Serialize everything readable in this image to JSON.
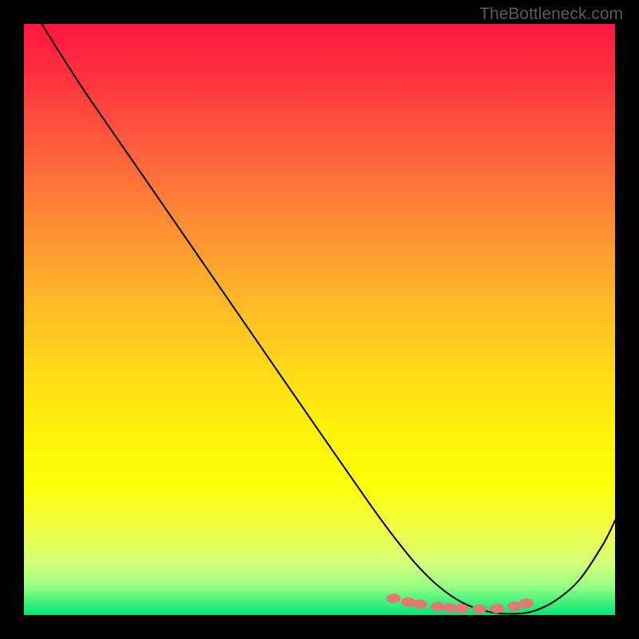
{
  "watermark": "TheBottleneck.com",
  "chart_data": {
    "type": "line",
    "title": "",
    "xlabel": "",
    "ylabel": "",
    "xlim": [
      0,
      100
    ],
    "ylim": [
      0,
      100
    ],
    "series": [
      {
        "name": "curve",
        "x": [
          3,
          10,
          20,
          30,
          40,
          50,
          58,
          62,
          66,
          70,
          74,
          78,
          82,
          86,
          90,
          94,
          98,
          100
        ],
        "y": [
          100,
          89,
          74.5,
          60,
          45.5,
          31,
          19.5,
          14,
          9,
          5,
          2.2,
          0.7,
          0.2,
          0.6,
          2.5,
          6,
          12,
          16
        ]
      }
    ],
    "markers": {
      "name": "dots",
      "color": "#e07a74",
      "x": [
        62.5,
        65,
        67,
        70,
        72,
        74,
        77,
        80,
        83,
        85
      ],
      "y": [
        2.8,
        2.2,
        1.8,
        1.4,
        1.2,
        1.1,
        1.0,
        1.1,
        1.5,
        2.0
      ]
    }
  }
}
